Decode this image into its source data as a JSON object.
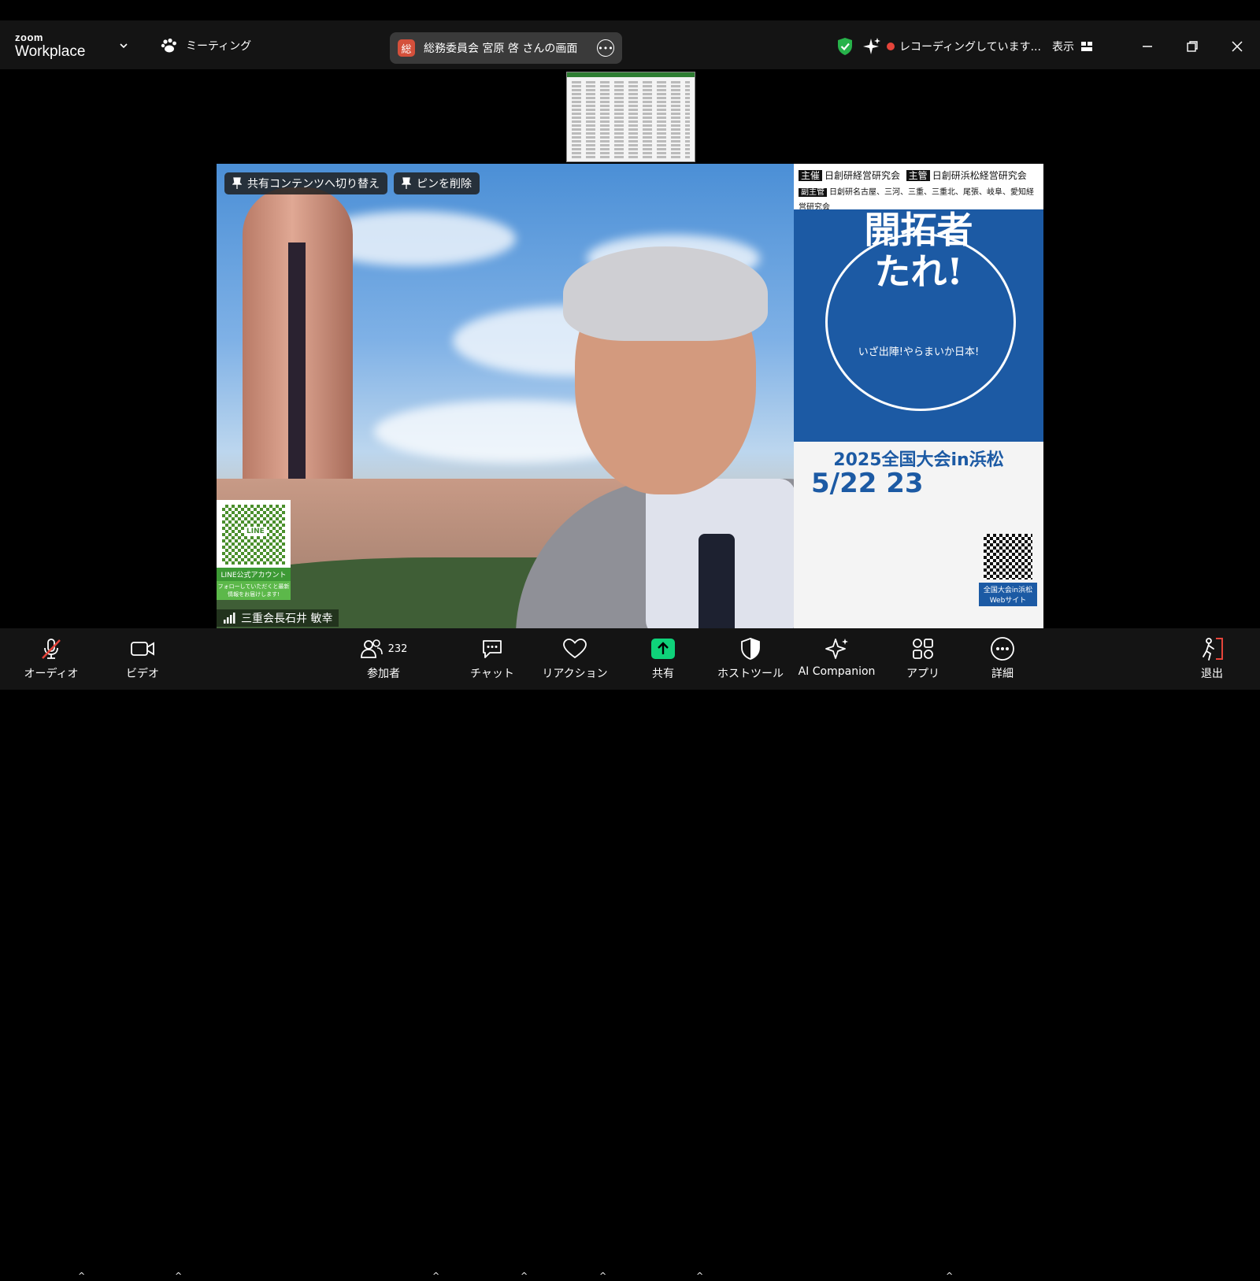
{
  "app": {
    "brand_line1": "zoom",
    "brand_line2": "Workplace",
    "menu_label": "ミーティング"
  },
  "share_bar": {
    "badge": "総",
    "title": "総務委員会 宮原 啓 さんの画面"
  },
  "status": {
    "recording": "レコーディングしています...",
    "view_label": "表示"
  },
  "video": {
    "pin_buttons": [
      "共有コンテンツへ切り替え",
      "ピンを削除"
    ],
    "participant_name": "三重会長石井 敏幸",
    "line_qr_label": "LINE",
    "line_account": "LINE公式アカウント",
    "line_follow": "フォローしていただくと最新情報をお届けします!"
  },
  "poster": {
    "organizers": [
      [
        "主催",
        "日創研経営研究会"
      ],
      [
        "主管",
        "日創研浜松経営研究会"
      ],
      [
        "副主管",
        "日創研名古屋、三河、三重、三重北、尾張、岐阜、愛知経営研究会"
      ]
    ],
    "main_lines": [
      "開拓者",
      "たれ!"
    ],
    "sub": "いざ出陣!やらまいか日本!",
    "event": "2025全国大会in浜松",
    "date": "5/22 23",
    "web": "全国大会in浜松 Webサイト"
  },
  "toolbar": {
    "audio": "オーディオ",
    "video": "ビデオ",
    "participants": "参加者",
    "participant_count": "232",
    "chat": "チャット",
    "reactions": "リアクション",
    "share": "共有",
    "host_tools": "ホストツール",
    "ai_companion": "AI Companion",
    "apps": "アプリ",
    "more": "詳細",
    "leave": "退出"
  },
  "colors": {
    "share_green": "#0fd27a",
    "shield_green": "#27b24a",
    "recording_red": "#e5443a",
    "leave_red": "#e5443a",
    "badge_red": "#d4503b"
  },
  "icons": [
    "paw-icon",
    "chevron-down-icon",
    "ellipsis-icon",
    "shield-check-icon",
    "sparkle-icon",
    "record-icon",
    "grid-icon",
    "minimize-icon",
    "restore-icon",
    "close-icon",
    "pin-icon",
    "signal-icon",
    "mic-muted-icon",
    "camera-icon",
    "people-icon",
    "chat-icon",
    "heart-icon",
    "share-arrow-icon",
    "host-shield-icon",
    "apps-icon",
    "more-icon",
    "leave-icon"
  ]
}
